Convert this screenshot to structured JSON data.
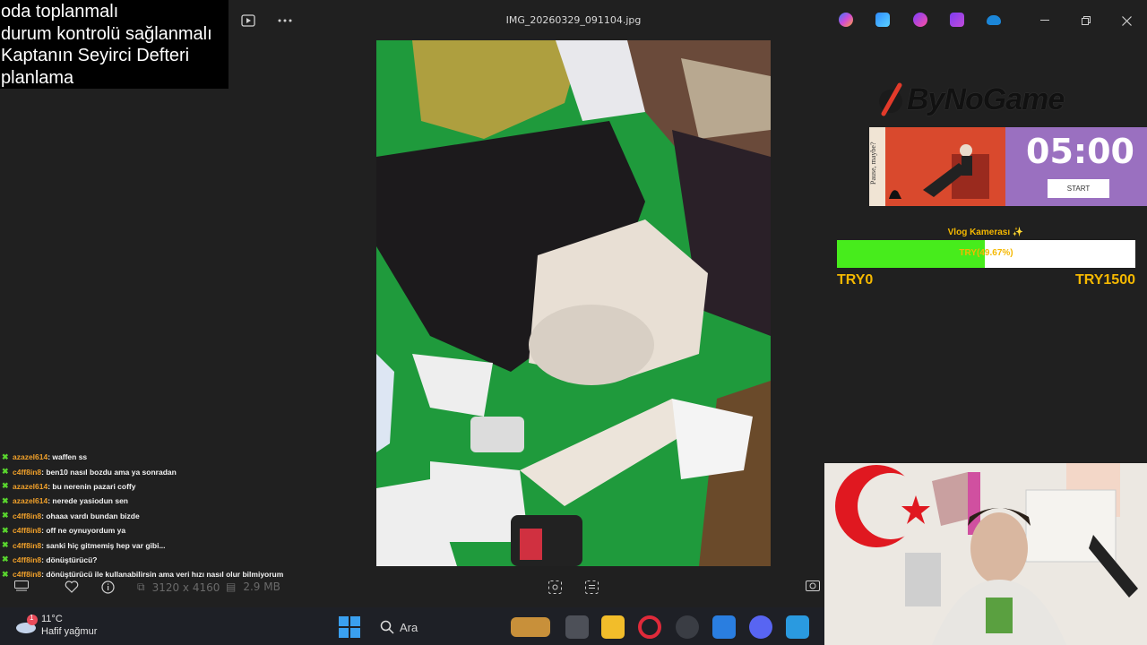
{
  "window": {
    "filename": "IMG_20260329_091104.jpg",
    "dimensions": "3120 x 4160",
    "filesize": "2.9 MB"
  },
  "notes": [
    "oda toplanmalı",
    "durum kontrolü sağlanmalı",
    "Kaptanın Seyirci Defteri",
    "planlama"
  ],
  "chat": [
    {
      "user": "azazel614",
      "message": ": waffen ss"
    },
    {
      "user": "c4ff8in8",
      "message": ": ben10 nasıl bozdu ama ya sonradan"
    },
    {
      "user": "azazel614",
      "message": ": bu nerenin pazari coffy"
    },
    {
      "user": "azazel614",
      "message": ": nerede yasiodun sen"
    },
    {
      "user": "c4ff8in8",
      "message": ": ohaaa vardı bundan bizde"
    },
    {
      "user": "c4ff8in8",
      "message": ": off ne oynuyordum ya"
    },
    {
      "user": "c4ff8in8",
      "message": ": sanki hiç gitmemiş hep var gibi..."
    },
    {
      "user": "c4ff8in8",
      "message": ": dönüştürücü?"
    },
    {
      "user": "c4ff8in8",
      "message": ": dönüştürücü ile kullanabilirsin ama veri hızı nasıl olur bilmiyorum"
    }
  ],
  "overlay": {
    "brand": "ByNoGame",
    "timer_side_text": "Pause, maybe?",
    "timer": "05:00",
    "start_label": "START",
    "goal_title": "Vlog Kamerası ✨",
    "goal_percent_text": "TRY(49.67%)",
    "goal_fraction": 0.4967,
    "goal_min": "TRY0",
    "goal_max": "TRY1500"
  },
  "taskbar": {
    "temperature": "11°C",
    "weather": "Hafif yağmur",
    "search_label": "Ara",
    "notification_count": "1"
  },
  "colors": {
    "accent_green": "#47ec1c",
    "goal_text": "#f5b800",
    "chat_user": "#f0a02a"
  }
}
